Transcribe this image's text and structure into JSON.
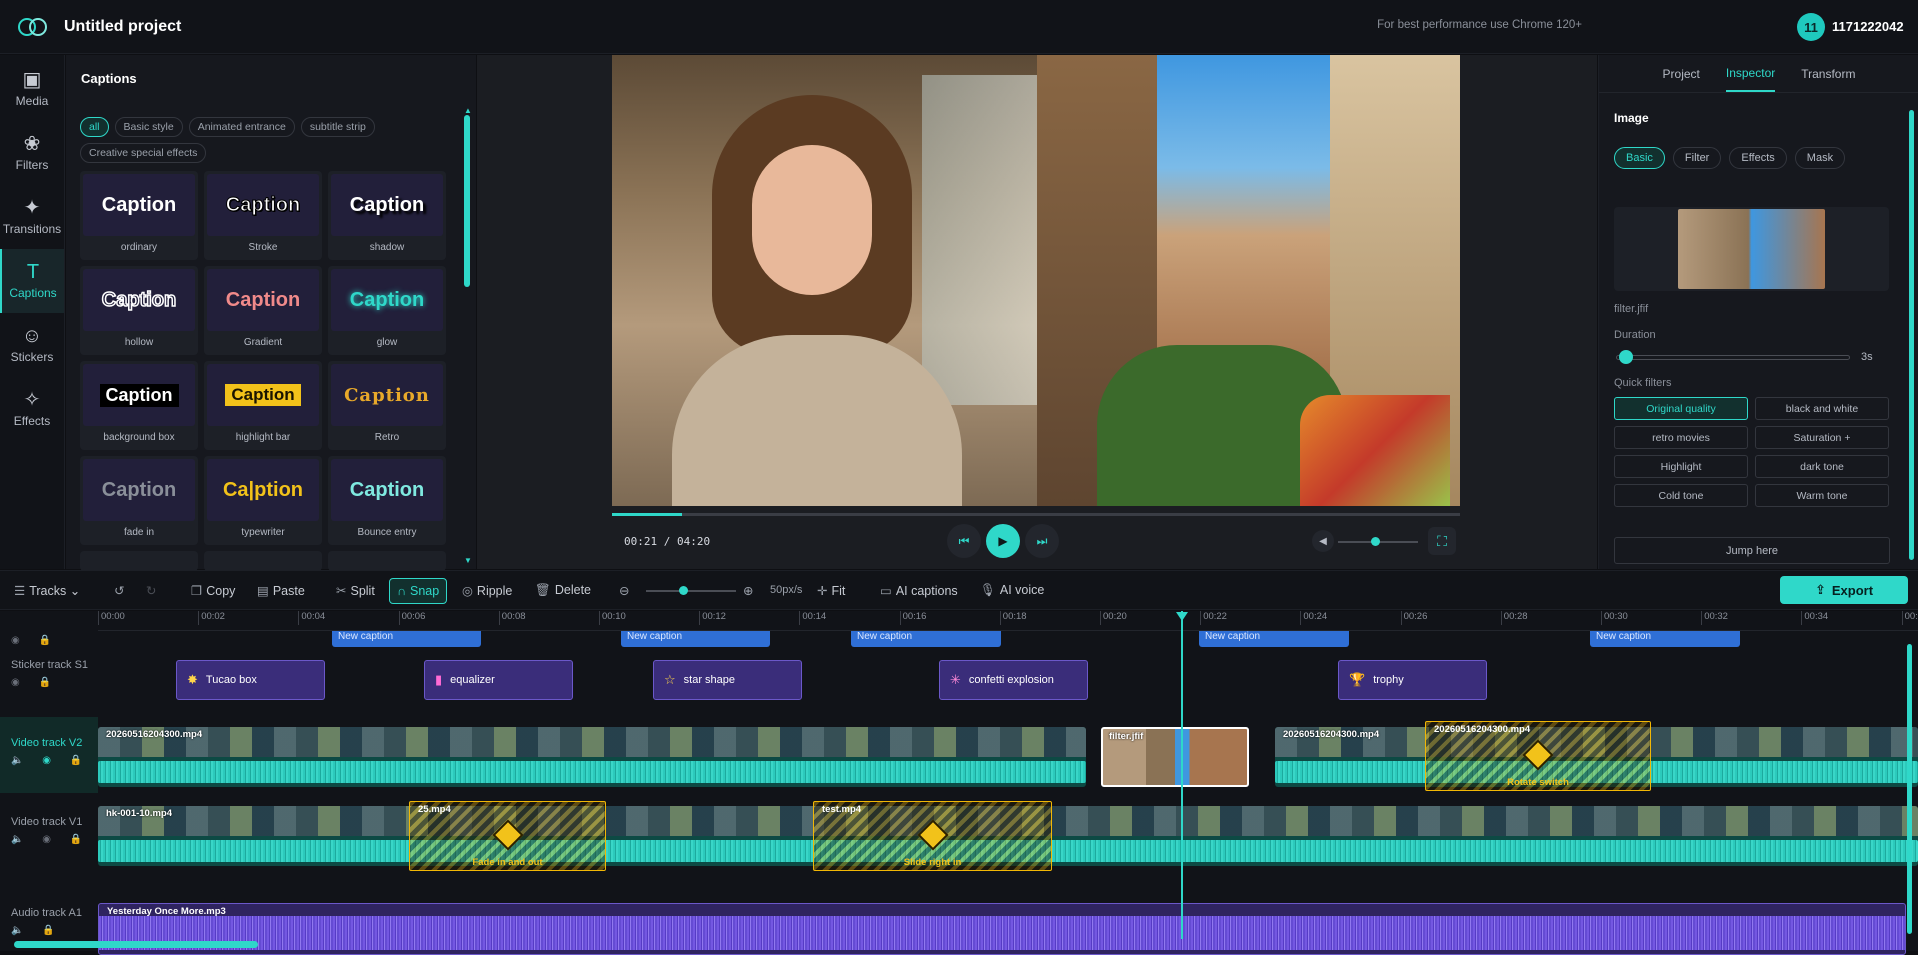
{
  "header": {
    "title": "Untitled project",
    "perf_note": "For best performance use Chrome 120+",
    "avatar_text": "11",
    "user_id": "1171222042"
  },
  "nav": [
    {
      "label": "Media",
      "icon": "media-icon"
    },
    {
      "label": "Filters",
      "icon": "filters-icon"
    },
    {
      "label": "Transitions",
      "icon": "transitions-icon"
    },
    {
      "label": "Captions",
      "icon": "captions-icon"
    },
    {
      "label": "Stickers",
      "icon": "stickers-icon"
    },
    {
      "label": "Effects",
      "icon": "effects-icon"
    }
  ],
  "captions_panel": {
    "title": "Captions",
    "chips": [
      "all",
      "Basic style",
      "Animated entrance",
      "subtitle strip",
      "Creative special effects"
    ],
    "items": [
      {
        "sample": "Caption",
        "name": "ordinary"
      },
      {
        "sample": "Caption",
        "name": "Stroke"
      },
      {
        "sample": "Caption",
        "name": "shadow"
      },
      {
        "sample": "Caption",
        "name": "hollow"
      },
      {
        "sample": "Caption",
        "name": "Gradient"
      },
      {
        "sample": "Caption",
        "name": "glow"
      },
      {
        "sample": "Caption",
        "name": "background box"
      },
      {
        "sample": "Caption",
        "name": "highlight bar"
      },
      {
        "sample": "Caption",
        "name": "Retro"
      },
      {
        "sample": "Caption",
        "name": "fade in"
      },
      {
        "sample": "Ca|ption",
        "name": "typewriter"
      },
      {
        "sample": "Caption",
        "name": "Bounce entry"
      }
    ]
  },
  "player": {
    "time": "00:21 / 04:20",
    "progress": 0.082,
    "volume": 0.5
  },
  "inspector": {
    "tabs": [
      "Project",
      "Inspector",
      "Transform"
    ],
    "section": "Image",
    "subtabs": [
      "Basic",
      "Filter",
      "Effects",
      "Mask"
    ],
    "filename": "filter.jfif",
    "duration_label": "Duration",
    "duration_value": "3s",
    "quick_filters_label": "Quick filters",
    "quick_filters": [
      "Original quality",
      "black and white",
      "retro movies",
      "Saturation +",
      "Highlight",
      "dark tone",
      "Cold tone",
      "Warm tone"
    ],
    "jump_label": "Jump here"
  },
  "toolbar": {
    "tracks": "Tracks",
    "copy": "Copy",
    "paste": "Paste",
    "split": "Split",
    "snap": "Snap",
    "ripple": "Ripple",
    "delete": "Delete",
    "zoom": "50px/s",
    "fit": "Fit",
    "ai_captions": "AI captions",
    "ai_voice": "AI voice",
    "export": "Export"
  },
  "timeline": {
    "ruler": [
      "00:00",
      "00:02",
      "00:04",
      "00:06",
      "00:08",
      "00:10",
      "00:12",
      "00:14",
      "00:16",
      "00:18",
      "00:20",
      "00:22",
      "00:24",
      "00:26",
      "00:28",
      "00:30",
      "00:32",
      "00:34",
      "00:3"
    ],
    "tracks": [
      "Sticker track S1",
      "Video track V2",
      "Video track V1",
      "Audio track A1"
    ],
    "caption_clip": "New caption",
    "stickers": [
      {
        "label": "Tucao box",
        "icon": "star-burst-icon"
      },
      {
        "label": "equalizer",
        "icon": "equalizer-icon"
      },
      {
        "label": "star shape",
        "icon": "star-icon"
      },
      {
        "label": "confetti explosion",
        "icon": "confetti-icon"
      },
      {
        "label": "trophy",
        "icon": "trophy-icon"
      }
    ],
    "v2_clips": [
      "20260516204300.mp4",
      "filter.jfif",
      "20260516204300.mp4",
      "20260516204300.mp4"
    ],
    "v2_transition": "Rotate switch",
    "v1_clips": [
      "hk-001-10.mp4",
      "25.mp4",
      "test.mp4"
    ],
    "v1_transitions": [
      "Fade in and out",
      "Slide right in"
    ],
    "audio_clip": "Yesterday Once More.mp3"
  }
}
